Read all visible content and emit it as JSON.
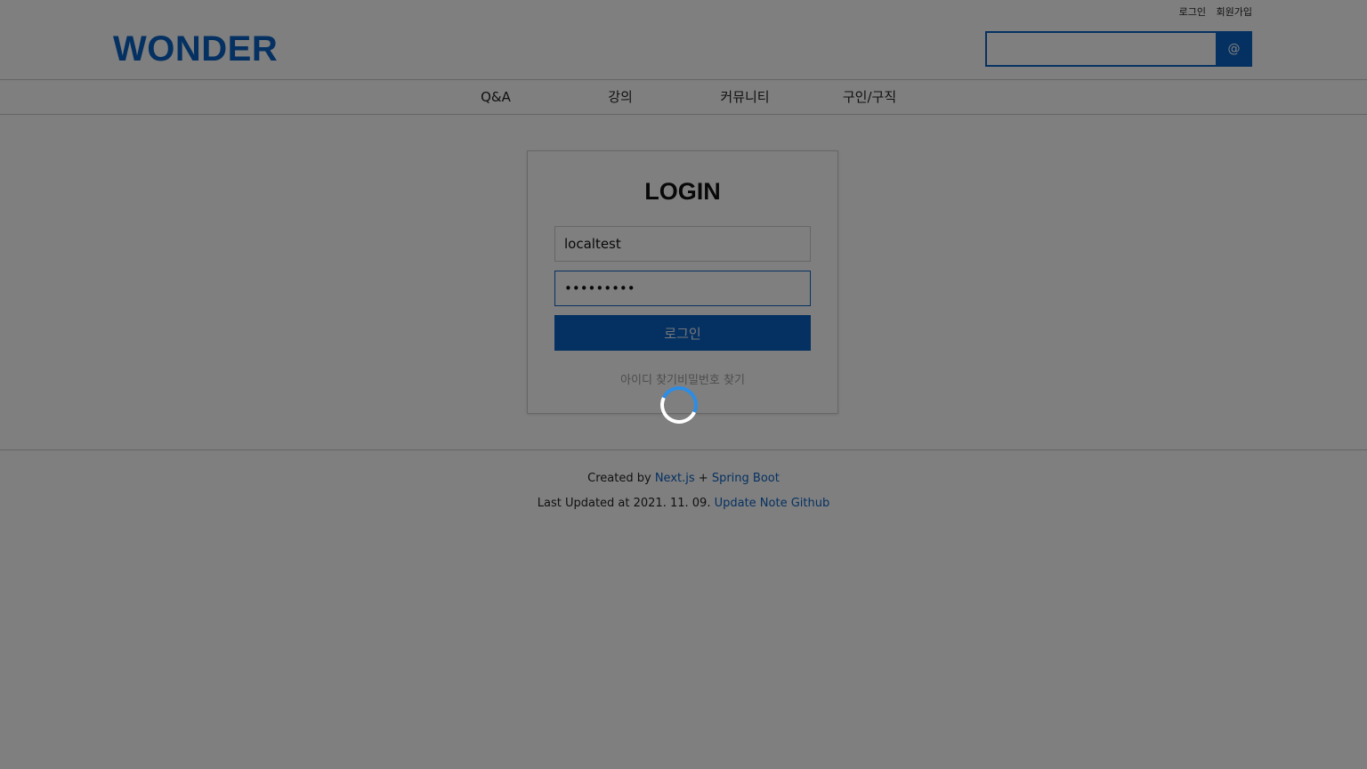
{
  "header": {
    "top_links": {
      "login": "로그인",
      "signup": "회원가입"
    },
    "logo": "WONDER",
    "search": {
      "value": "",
      "placeholder": "",
      "button_label": "@"
    }
  },
  "nav": {
    "items": [
      {
        "label": "Q&A"
      },
      {
        "label": "강의"
      },
      {
        "label": "커뮤니티"
      },
      {
        "label": "구인/구직"
      }
    ]
  },
  "login": {
    "title": "LOGIN",
    "username": {
      "value": "localtest"
    },
    "password": {
      "value": "•••••••••"
    },
    "button_label": "로그인",
    "find_id": "아이디 찾기",
    "find_password": "비밀번호 찾기"
  },
  "footer": {
    "created_prefix": "Created by ",
    "nextjs": "Next.js",
    "plus": " + ",
    "spring": "Spring Boot",
    "updated_prefix": "Last Updated at 2021. 11. 09. ",
    "update_note": "Update Note",
    "github": "Github"
  },
  "overlay": {
    "spinner": "loading-spinner-icon",
    "colors": {
      "spinner_arc": "#2b8de6",
      "spinner_track": "#ffffff"
    }
  },
  "colors": {
    "brand": "#0b63c4"
  }
}
